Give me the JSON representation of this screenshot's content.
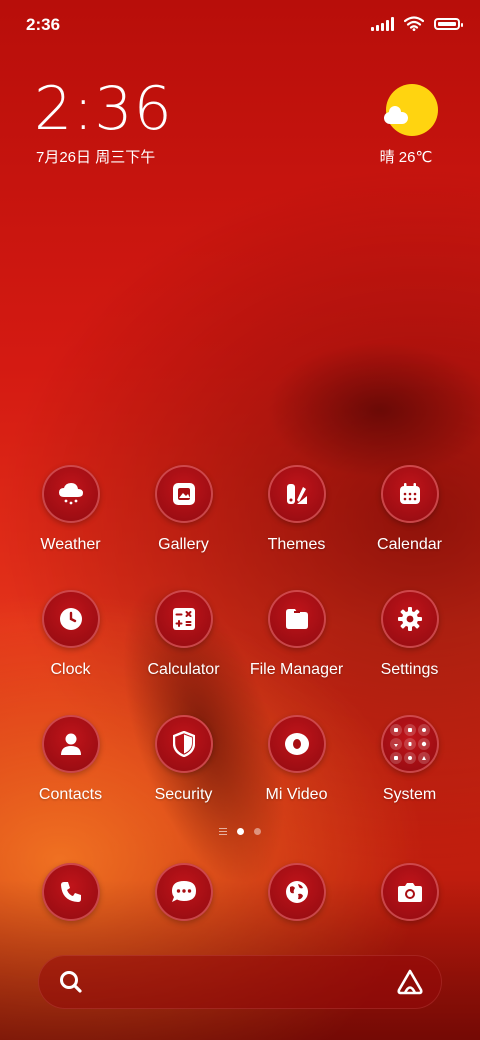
{
  "status_bar": {
    "time": "2:36"
  },
  "clock_widget": {
    "time": "2:36",
    "date": "7月26日 周三下午"
  },
  "weather_widget": {
    "text": "晴 26℃",
    "sun_color": "#ffd410"
  },
  "apps": [
    {
      "label": "Weather",
      "icon": "weather-icon"
    },
    {
      "label": "Gallery",
      "icon": "gallery-icon"
    },
    {
      "label": "Themes",
      "icon": "themes-icon"
    },
    {
      "label": "Calendar",
      "icon": "calendar-icon"
    },
    {
      "label": "Clock",
      "icon": "clock-icon"
    },
    {
      "label": "Calculator",
      "icon": "calculator-icon"
    },
    {
      "label": "File Manager",
      "icon": "folder-icon"
    },
    {
      "label": "Settings",
      "icon": "gear-icon"
    },
    {
      "label": "Contacts",
      "icon": "person-icon"
    },
    {
      "label": "Security",
      "icon": "shield-icon"
    },
    {
      "label": "Mi Video",
      "icon": "video-icon"
    },
    {
      "label": "System",
      "icon": "folder-grid-icon"
    }
  ],
  "dock": [
    {
      "icon": "phone-icon"
    },
    {
      "icon": "message-icon"
    },
    {
      "icon": "browser-icon"
    },
    {
      "icon": "camera-icon"
    }
  ],
  "page_indicator": {
    "pages": 2,
    "current": 1
  },
  "search_bar": {
    "icon": "search-icon",
    "brand_icon": "assistant-icon"
  },
  "theme": {
    "accent": "#c0141a"
  }
}
